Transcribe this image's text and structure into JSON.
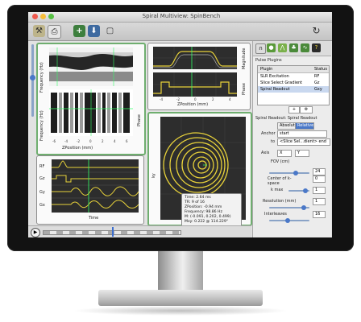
{
  "window": {
    "title": "Spiral Multiview: SpinBench"
  },
  "toolbar": {
    "buttons": [
      "tools-icon",
      "print-icon",
      "add-icon",
      "save-icon",
      "lock-icon",
      "refresh-icon"
    ]
  },
  "plots": {
    "phase_top": {
      "ylabel_top": "Frequency (Hz)",
      "ylabel_bottom": "Frequency (Hz)",
      "right_label": "Phase",
      "xlabel": "ZPosition (mm)",
      "xticks": [
        "-6",
        "-4",
        "-2",
        "0",
        "2",
        "4",
        "6"
      ]
    },
    "magnitude": {
      "right_label": "Magnitude",
      "mid_label": "Phase",
      "xlabel": "ZPosition (mm)",
      "xticks": [
        "-4",
        "-2",
        "0",
        "2",
        "4"
      ]
    },
    "gradients": {
      "labels": [
        "RF",
        "Gz",
        "Gy",
        "Gx"
      ],
      "xlabel": "Time"
    },
    "spiral": {
      "ylabel": "ky"
    }
  },
  "tooltip": {
    "lines": [
      "Time: 2.64 ms",
      "TR:   9 of 16",
      "ZPosition: -0.94 mm",
      "Frequency: 98.86 Hz",
      "M: (-0.091, 0.202, 0.499)",
      "Mxy: 0.222 @ 114.229°"
    ]
  },
  "right_panel": {
    "pulse_plugins_title": "Pulse Plugins",
    "table_headers": [
      "Plugin",
      "Status"
    ],
    "plugins": [
      {
        "name": "SLR Excitation",
        "status": "RF"
      },
      {
        "name": "Slice Select Gradient",
        "status": "Gz"
      },
      {
        "name": "Spiral Readout",
        "status": "Gxy"
      }
    ],
    "readout_title": "Spiral Readout: Spiral Readout",
    "tabs": [
      "Absolute",
      "Relative"
    ],
    "anchor_label": "Anchor",
    "anchor_value": "start",
    "to_label": "to",
    "to_value": "<Slice Sel...dient> end",
    "axis_label": "Axis",
    "axis_values": [
      "X",
      "Y"
    ],
    "fov_label": "FOV (cm)",
    "fov_value": "24",
    "center_label": "Center of k-space",
    "center_value": "0",
    "kmax_label": "k max",
    "kmax_value": "1",
    "resolution_label": "Resolution (mm)",
    "resolution_value": "1",
    "interleaves_label": "Interleaves",
    "interleaves_value": "16"
  }
}
